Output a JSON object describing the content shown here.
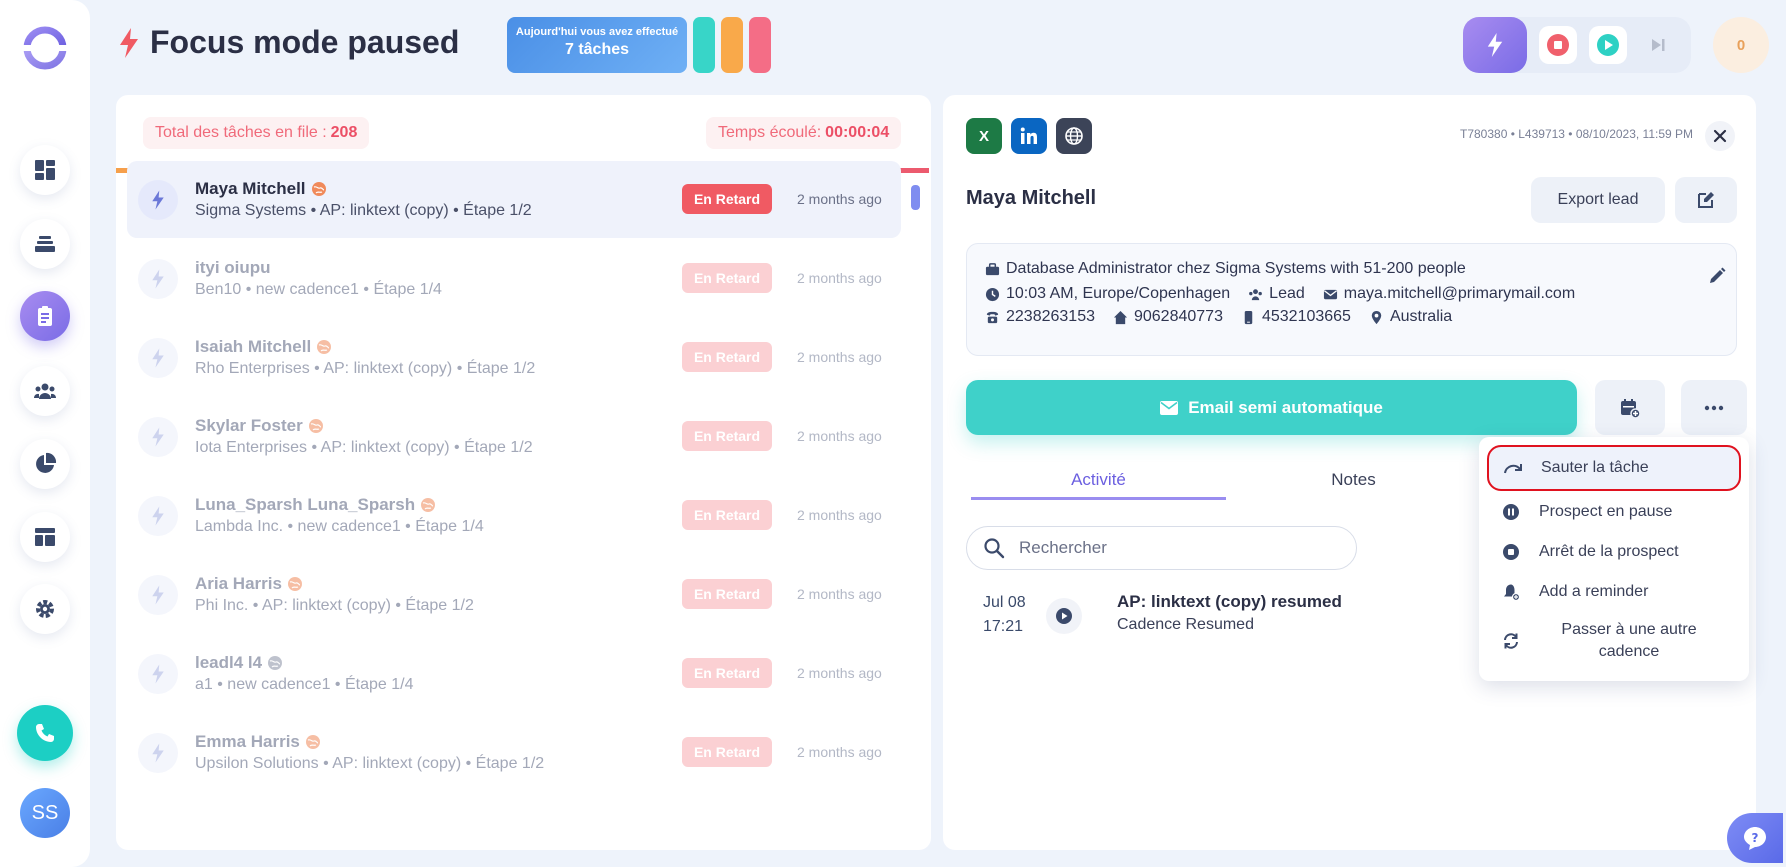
{
  "header": {
    "title": "Focus mode paused",
    "today_line1": "Aujourd'hui vous avez effectué",
    "today_line2": "7 tâches",
    "counter": "0"
  },
  "sidebar": {
    "avatar_initials": "SS",
    "items": [
      "dashboard",
      "tasks-stack",
      "tasks-list",
      "team",
      "reports",
      "layout",
      "settings"
    ]
  },
  "queue": {
    "total_label": "Total des tâches en file :",
    "total_value": "208",
    "elapsed_label": "Temps écoulé:",
    "elapsed_value": "00:00:04",
    "tasks": [
      {
        "name": "Maya Mitchell",
        "sub": "Sigma Systems • AP: linktext (copy) • Étape 1/2",
        "badge": "En Retard",
        "time": "2 months ago",
        "lang": "orange"
      },
      {
        "name": "ityi oiupu",
        "sub": "Ben10 • new cadence1 • Étape 1/4",
        "badge": "En Retard",
        "time": "2 months ago",
        "lang": ""
      },
      {
        "name": "Isaiah Mitchell",
        "sub": "Rho Enterprises • AP: linktext (copy) • Étape 1/2",
        "badge": "En Retard",
        "time": "2 months ago",
        "lang": "orange"
      },
      {
        "name": "Skylar Foster",
        "sub": "Iota Enterprises • AP: linktext (copy) • Étape 1/2",
        "badge": "En Retard",
        "time": "2 months ago",
        "lang": "orange"
      },
      {
        "name": "Luna_Sparsh Luna_Sparsh",
        "sub": "Lambda Inc. • new cadence1 • Étape 1/4",
        "badge": "En Retard",
        "time": "2 months ago",
        "lang": "orange"
      },
      {
        "name": "Aria Harris",
        "sub": "Phi Inc. • AP: linktext (copy) • Étape 1/2",
        "badge": "En Retard",
        "time": "2 months ago",
        "lang": "orange"
      },
      {
        "name": "leadl4 l4",
        "sub": "a1 • new cadence1 • Étape 1/4",
        "badge": "En Retard",
        "time": "2 months ago",
        "lang": "gray"
      },
      {
        "name": "Emma Harris",
        "sub": "Upsilon Solutions • AP: linktext (copy) • Étape 1/2",
        "badge": "En Retard",
        "time": "2 months ago",
        "lang": "orange"
      }
    ]
  },
  "lead": {
    "meta": "T780380 • L439713 • 08/10/2023, 11:59 PM",
    "excel_label": "X",
    "name": "Maya Mitchell",
    "export_label": "Export lead",
    "job": "Database Administrator chez Sigma Systems with 51-200 people",
    "timezone": "10:03 AM, Europe/Copenhagen",
    "type": "Lead",
    "email": "maya.mitchell@primarymail.com",
    "phone1": "2238263153",
    "phone2": "9062840773",
    "phone3": "4532103665",
    "country": "Australia",
    "email_button": "Email semi automatique",
    "tabs": [
      "Activité",
      "Notes"
    ],
    "search_placeholder": "Rechercher",
    "activity": {
      "date": "Jul 08",
      "time": "17:21",
      "title": "AP: linktext (copy) resumed",
      "sub": "Cadence Resumed"
    }
  },
  "menu": {
    "items": [
      {
        "label": "Sauter la tâche",
        "icon": "skip-icon"
      },
      {
        "label": "Prospect en pause",
        "icon": "pause-icon"
      },
      {
        "label": "Arrêt de la prospect",
        "icon": "stop-icon"
      },
      {
        "label": "Add a reminder",
        "icon": "bell-icon"
      },
      {
        "label": "Passer à une autre cadence",
        "icon": "refresh-icon"
      }
    ]
  },
  "colors": {
    "accent": "#7a6ce6",
    "teal": "#3fd1c9",
    "late": "#f05a63",
    "chip1": "#38d5c8",
    "chip2": "#f9a94a",
    "chip3": "#f46d86"
  }
}
